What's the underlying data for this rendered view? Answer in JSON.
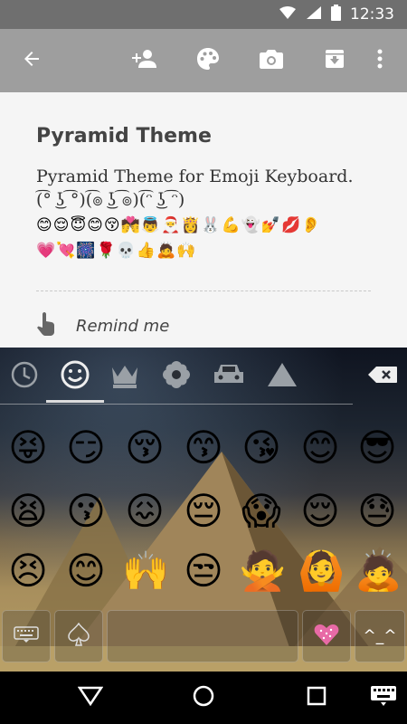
{
  "status_bar": {
    "time": "12:33"
  },
  "note": {
    "title": "Pyramid Theme",
    "body_line1": "Pyramid Theme for Emoji Keyboard.",
    "body_line2": "(͡° ͜ʖ ͡°)(͡๏ ͜ʖ ͡๏)(͡ᵔ ͜ʖ ͡ᵔ)",
    "emoji_line1": "😊😌😇😊😚💏👼🎅👸🐰💪👻💅💋👂",
    "emoji_line2": "💗💘🎆🌹💀👍🙇🙌",
    "reminder_label": "Remind me"
  },
  "keyboard": {
    "tabs": [
      "recent-tab",
      "smileys-tab",
      "objects-tab",
      "nature-tab",
      "places-tab",
      "symbols-tab"
    ],
    "emoji_rows": [
      [
        "😝",
        "😏",
        "😚",
        "😙",
        "😘",
        "😊",
        "😎"
      ],
      [
        "😫",
        "😗",
        "😖",
        "😔",
        "😱",
        "😌",
        "😓"
      ],
      [
        "😣",
        "😊",
        "🙌",
        "😒",
        "🙅",
        "🙆",
        "🙇"
      ]
    ],
    "bottom_row": {
      "emoticon_label": "^_^"
    }
  }
}
